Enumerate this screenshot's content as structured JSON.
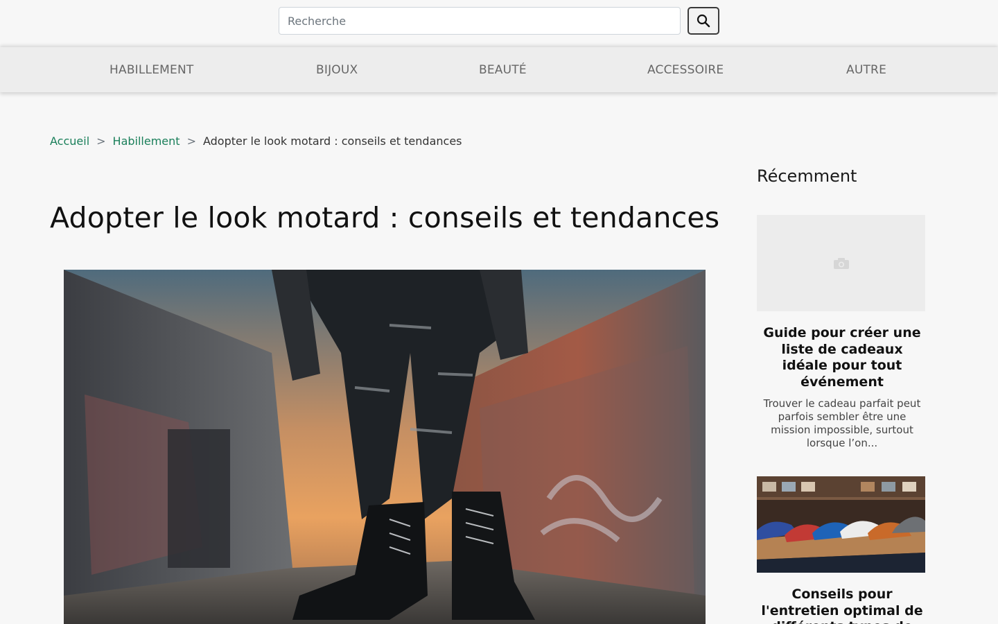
{
  "search": {
    "placeholder": "Recherche",
    "value": ""
  },
  "nav": {
    "items": [
      {
        "label": "HABILLEMENT"
      },
      {
        "label": "BIJOUX"
      },
      {
        "label": "BEAUTÉ"
      },
      {
        "label": "ACCESSOIRE"
      },
      {
        "label": "AUTRE"
      }
    ]
  },
  "breadcrumb": {
    "home": "Accueil",
    "category": "Habillement",
    "current": "Adopter le look motard : conseils et tendances",
    "separator": ">"
  },
  "article": {
    "title": "Adopter le look motard : conseils et tendances",
    "image_icon": "photo-hero"
  },
  "sidebar": {
    "title": "Récemment",
    "cards": [
      {
        "title": "Guide pour créer une liste de cadeaux idéale pour tout événement",
        "excerpt": "Trouver le cadeau parfait peut parfois sembler être une mission impossible, surtout lorsque l’on...",
        "thumb_icon": "camera-icon"
      },
      {
        "title": "Conseils pour l'entretien optimal de différents types de chaussures",
        "thumb_icon": "sneakers-photo"
      }
    ]
  },
  "colors": {
    "link": "#1a7f5a",
    "nav_bg": "#ededed",
    "page_bg": "#f7f7f7"
  }
}
